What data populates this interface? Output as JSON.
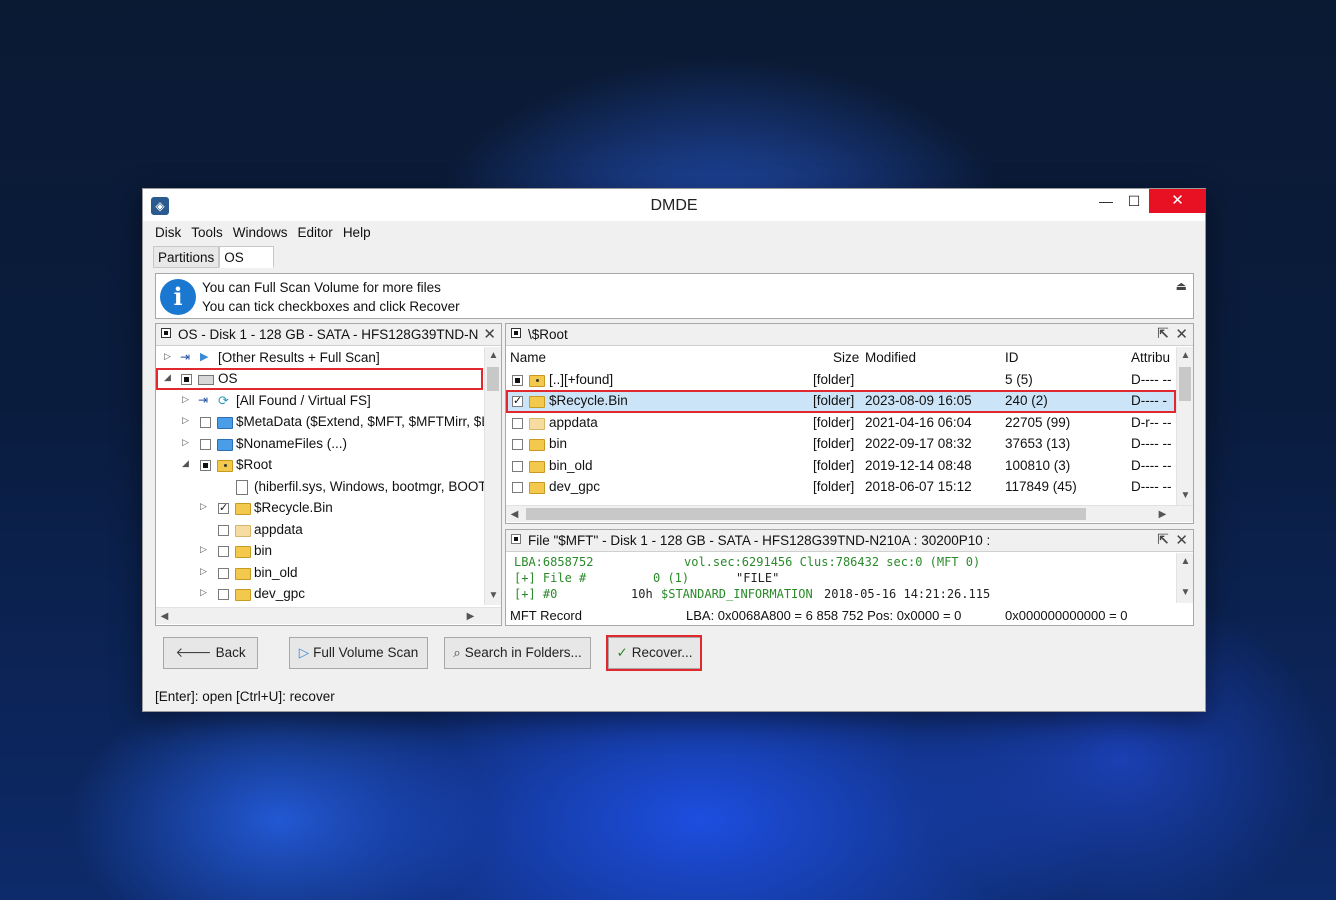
{
  "window": {
    "title": "DMDE",
    "minimize": "—",
    "maximize": "☐",
    "close": "✕"
  },
  "menu": [
    "Disk",
    "Tools",
    "Windows",
    "Editor",
    "Help"
  ],
  "tabs": [
    "Partitions",
    "OS"
  ],
  "info": {
    "line1": "You can Full Scan Volume for more files",
    "line2": "You can tick checkboxes and click Recover"
  },
  "tree": {
    "title": "OS - Disk 1 - 128 GB - SATA - HFS128G39TND-N...",
    "items": [
      {
        "label": "[Other Results + Full Scan]"
      },
      {
        "label": "OS"
      },
      {
        "label": "[All Found / Virtual FS]"
      },
      {
        "label": "$MetaData ($Extend, $MFT, $MFTMirr, $Lo"
      },
      {
        "label": "$NonameFiles (...)"
      },
      {
        "label": "$Root"
      },
      {
        "label": "(hiberfil.sys, Windows, bootmgr, BOOT"
      },
      {
        "label": "$Recycle.Bin"
      },
      {
        "label": "appdata"
      },
      {
        "label": "bin"
      },
      {
        "label": "bin_old"
      },
      {
        "label": "dev_gpc"
      }
    ]
  },
  "files": {
    "title": "\\$Root",
    "columns": {
      "name": "Name",
      "size": "Size",
      "modified": "Modified",
      "id": "ID",
      "attrib": "Attribu"
    },
    "rows": [
      {
        "name": "[..][+found]",
        "size": "[folder]",
        "modified": "",
        "id": "5 (5)",
        "attrib": "D---- --"
      },
      {
        "name": "$Recycle.Bin",
        "size": "[folder]",
        "modified": "2023-08-09 16:05",
        "id": "240 (2)",
        "attrib": "D---- -"
      },
      {
        "name": "appdata",
        "size": "[folder]",
        "modified": "2021-04-16 06:04",
        "id": "22705 (99)",
        "attrib": "D-r-- --"
      },
      {
        "name": "bin",
        "size": "[folder]",
        "modified": "2022-09-17 08:32",
        "id": "37653 (13)",
        "attrib": "D---- --"
      },
      {
        "name": "bin_old",
        "size": "[folder]",
        "modified": "2019-12-14 08:48",
        "id": "100810 (3)",
        "attrib": "D---- --"
      },
      {
        "name": "dev_gpc",
        "size": "[folder]",
        "modified": "2018-06-07 15:12",
        "id": "117849 (45)",
        "attrib": "D---- --"
      }
    ]
  },
  "record": {
    "title": "File \"$MFT\" - Disk 1 - 128 GB - SATA - HFS128G39TND-N210A : 30200P10 :",
    "line1a": "LBA:6858752",
    "line1b": "vol.sec:6291456 Clus:786432 sec:0 (MFT 0)",
    "line2a": "[+] File #",
    "line2b": "0 (1)",
    "line2c": "\"FILE\"",
    "line3a": "[+] #0",
    "line3b": "10h",
    "line3c": "$STANDARD_INFORMATION",
    "line3d": "2018-05-16 14:21:26.115",
    "footer_left": "MFT Record",
    "footer_mid": "LBA: 0x0068A800 = 6 858 752  Pos: 0x0000 = 0",
    "footer_right": "0x000000000000 = 0"
  },
  "buttons": {
    "back": "Back",
    "full_scan": "Full Volume Scan",
    "search": "Search in Folders...",
    "recover": "Recover..."
  },
  "status": "[Enter]: open  [Ctrl+U]: recover",
  "colors": {
    "accent_red": "#e0282e",
    "selection": "#cce4f7",
    "close_red": "#e81123",
    "info_blue": "#1b78d0"
  }
}
